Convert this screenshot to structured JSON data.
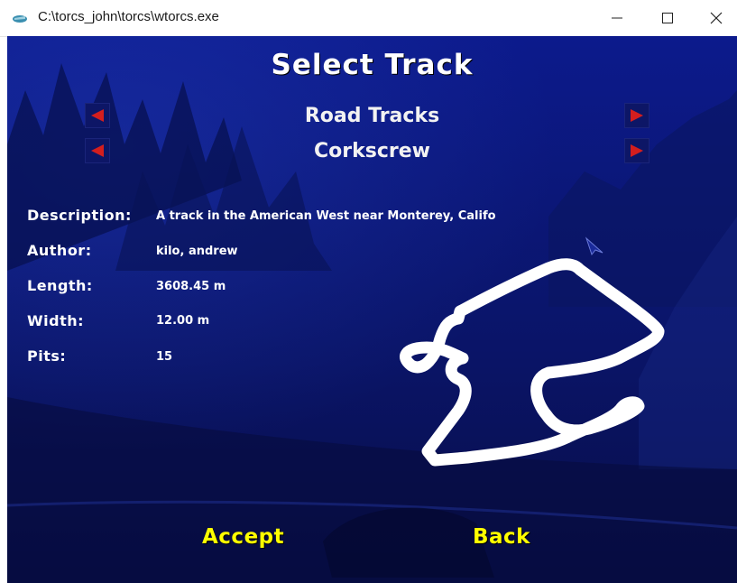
{
  "window": {
    "title": "C:\\torcs_john\\torcs\\wtorcs.exe"
  },
  "screen": {
    "title": "Select Track",
    "category": "Road Tracks",
    "track": "Corkscrew"
  },
  "info": {
    "description_label": "Description:",
    "description_value": "A track in the American West near Monterey, Califo",
    "author_label": "Author:",
    "author_value": "kilo, andrew",
    "length_label": "Length:",
    "length_value": "3608.45 m",
    "width_label": "Width:",
    "width_value": "12.00 m",
    "pits_label": "Pits:",
    "pits_value": "15"
  },
  "buttons": {
    "accept": "Accept",
    "back": "Back"
  },
  "colors": {
    "background": "#0b1778",
    "title_text": "#ffffff",
    "button_text": "#ffff00",
    "arrow": "#d41e1e",
    "track_outline": "#ffffff"
  },
  "icons": {
    "app": "torcs-app-icon",
    "minimize": "minimize-icon",
    "maximize": "maximize-icon",
    "close": "close-icon",
    "prev": "arrow-left-icon",
    "next": "arrow-right-icon",
    "cursor": "mouse-cursor-icon"
  }
}
